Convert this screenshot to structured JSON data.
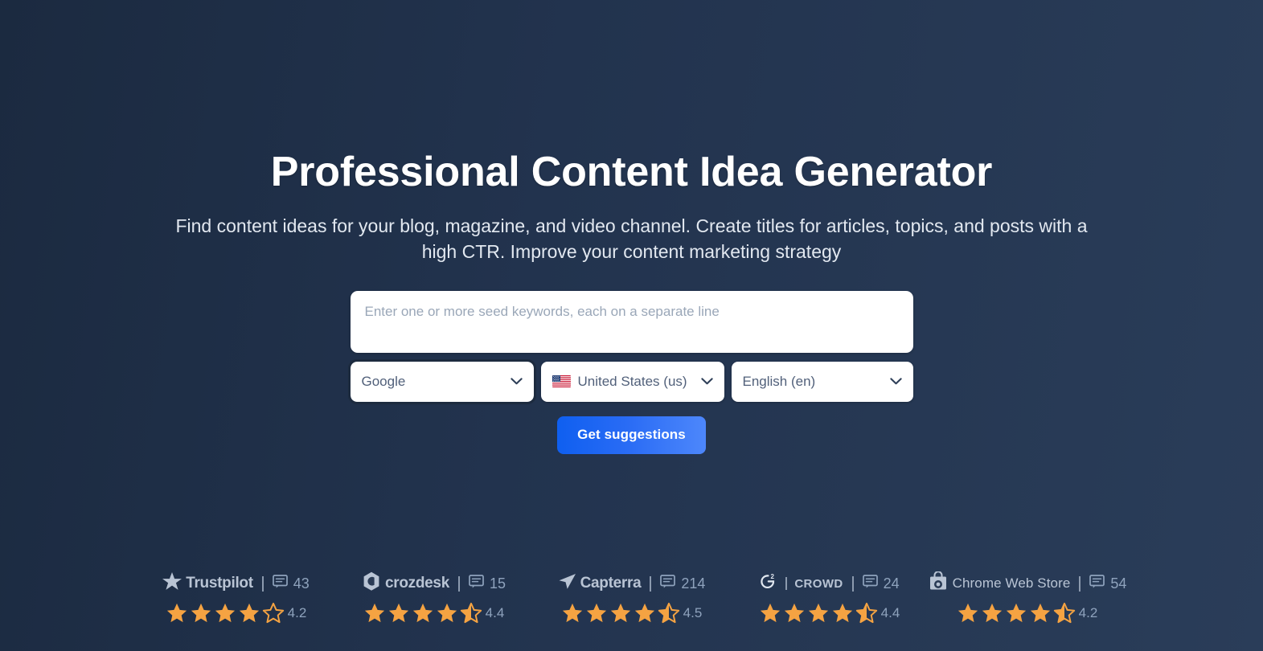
{
  "hero": {
    "title": "Professional Content Idea Generator",
    "subtitle": "Find content ideas for your blog, magazine, and video channel. Create titles for articles, topics, and posts with a high CTR. Improve your content marketing strategy"
  },
  "form": {
    "seed_placeholder": "Enter one or more seed keywords, each on a separate line",
    "seed_value": "",
    "engine": {
      "value": "Google",
      "focused": true
    },
    "country": {
      "value": "United States (us)",
      "flag": "us-flag-icon"
    },
    "language": {
      "value": "English (en)"
    },
    "submit_label": "Get suggestions"
  },
  "badges": [
    {
      "name": "trustpilot",
      "logo_text": "Trustpilot",
      "mark": "star-mark",
      "reviews": "43",
      "rating": "4.2",
      "full_stars": 4,
      "half_star": false,
      "empty_stars": 1
    },
    {
      "name": "crozdesk",
      "logo_text": "crozdesk",
      "mark": "hexagon-mark",
      "reviews": "15",
      "rating": "4.4",
      "full_stars": 4,
      "half_star": true,
      "empty_stars": 0
    },
    {
      "name": "capterra",
      "logo_text": "Capterra",
      "mark": "arrow-mark",
      "reviews": "214",
      "rating": "4.5",
      "full_stars": 4,
      "half_star": true,
      "empty_stars": 0
    },
    {
      "name": "g2crowd",
      "logo_text": "CROWD",
      "mark": "g2-mark",
      "reviews": "24",
      "rating": "4.4",
      "full_stars": 4,
      "half_star": true,
      "empty_stars": 0
    },
    {
      "name": "chrome-web-store",
      "logo_text": "Chrome Web Store",
      "mark": "bag-mark",
      "reviews": "54",
      "rating": "4.2",
      "full_stars": 4,
      "half_star": true,
      "empty_stars": 0
    }
  ],
  "colors": {
    "background_dark": "#1b2a40",
    "background_light": "#2a3d59",
    "accent_blue": "#2a6cf5",
    "star_orange": "#f5a342",
    "muted_text": "#8fa3bd"
  }
}
